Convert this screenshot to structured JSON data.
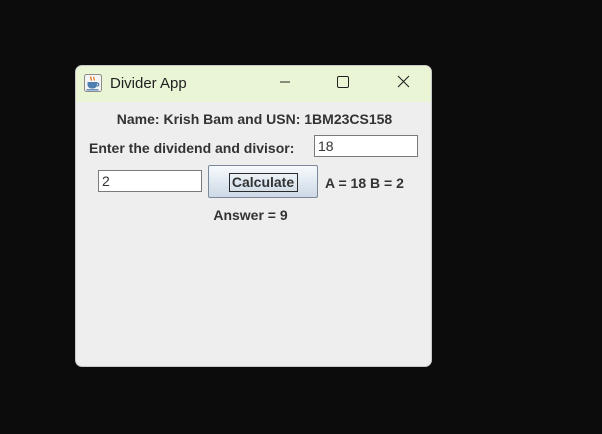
{
  "window": {
    "title": "Divider App",
    "app_icon": "java-coffee-cup-icon",
    "controls": {
      "minimize_icon": "minimize-icon",
      "maximize_icon": "maximize-icon",
      "close_icon": "close-icon"
    }
  },
  "form": {
    "name_label": "Name: Krish Bam and USN: 1BM23CS158",
    "prompt_label": "Enter the dividend and divisor:",
    "dividend_value": "18",
    "divisor_value": "2",
    "calculate_label": "Calculate",
    "values_label": "A = 18  B = 2",
    "answer_label": "Answer = 9"
  },
  "colors": {
    "desktop_background": "#0c0c0c",
    "titlebar_background": "#eaf5d6",
    "window_background": "#eeeeee",
    "label_text": "#333333"
  }
}
